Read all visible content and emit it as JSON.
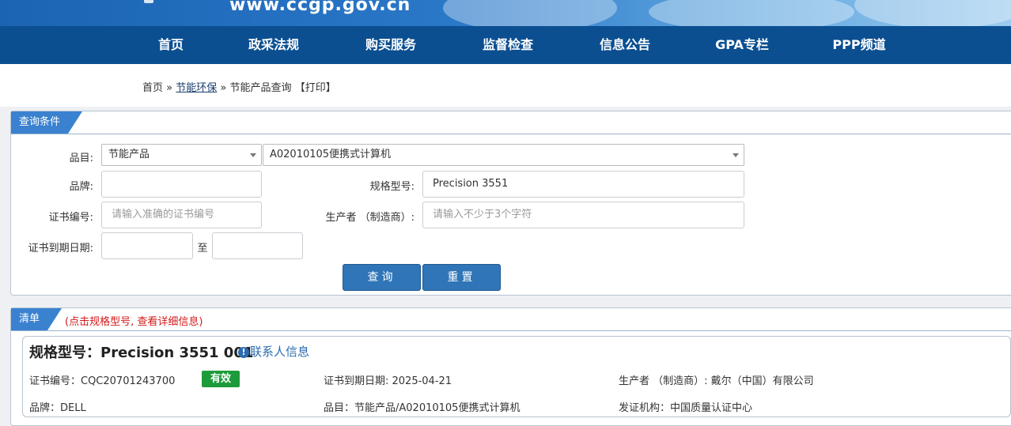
{
  "header": {
    "url": "www.ccgp.gov.cn"
  },
  "nav": [
    "首页",
    "政采法规",
    "购买服务",
    "监督检查",
    "信息公告",
    "GPA专栏",
    "PPP频道"
  ],
  "breadcrumb": {
    "home": "首页",
    "sep": "»",
    "section": "节能环保",
    "current": "节能产品查询",
    "print": "【打印】"
  },
  "query": {
    "tab": "查询条件",
    "category_label": "品目:",
    "category_value": "节能产品",
    "subcategory_value": "A02010105便携式计算机",
    "brand_label": "品牌:",
    "brand_value": "",
    "model_label": "规格型号:",
    "model_value": "Precision 3551",
    "cert_label": "证书编号:",
    "cert_placeholder": "请输入准确的证书编号",
    "maker_label": "生产者 （制造商）:",
    "maker_placeholder": "请输入不少于3个字符",
    "expiry_label": "证书到期日期:",
    "to_label": "至",
    "search_button": "查询",
    "reset_button": "重置"
  },
  "results": {
    "tab": "清单",
    "hint": "(点击规格型号, 查看详细信息)",
    "items": [
      {
        "title": "规格型号：Precision 3551 001",
        "contact": "联系人信息",
        "cert": "证书编号：CQC20701243700",
        "status": "有效",
        "expiry": "证书到期日期: 2025-04-21",
        "maker": "生产者 （制造商）: 戴尔（中国）有限公司",
        "brand": "品牌：DELL",
        "category": "品目：节能产品/A02010105便携式计算机",
        "issuer": "发证机构：中国质量认证中心"
      }
    ]
  },
  "colors": {
    "nav_bg": "#0b4f91",
    "tab_bg": "#3a82d0",
    "button_bg": "#2f75b7",
    "badge_bg": "#1d9b3a",
    "hint_color": "#d21a1a"
  }
}
